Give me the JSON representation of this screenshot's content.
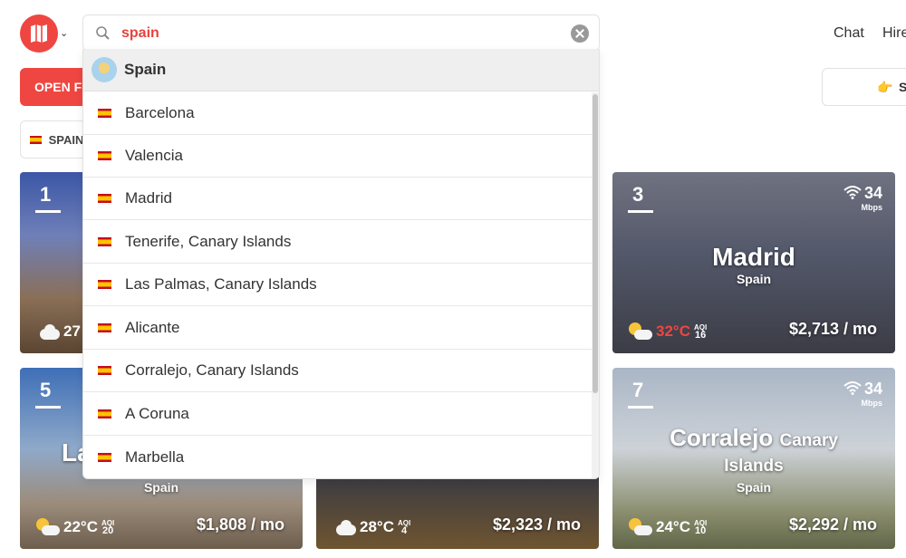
{
  "header": {
    "nav": {
      "chat": "Chat",
      "hire": "Hire"
    }
  },
  "search": {
    "value": "spain",
    "placeholder": ""
  },
  "page": {
    "open_filters_label": "OPEN FI",
    "country_chip_label": "SPAIN",
    "right_chip_label": "S"
  },
  "dropdown": {
    "header": {
      "label": "Spain",
      "icon": "globe-icon"
    },
    "items": [
      {
        "label": "Barcelona",
        "icon": "spain-flag-icon"
      },
      {
        "label": "Valencia",
        "icon": "spain-flag-icon"
      },
      {
        "label": "Madrid",
        "icon": "spain-flag-icon"
      },
      {
        "label": "Tenerife, Canary Islands",
        "icon": "spain-flag-icon"
      },
      {
        "label": "Las Palmas, Canary Islands",
        "icon": "spain-flag-icon"
      },
      {
        "label": "Alicante",
        "icon": "spain-flag-icon"
      },
      {
        "label": "Corralejo, Canary Islands",
        "icon": "spain-flag-icon"
      },
      {
        "label": "A Coruna",
        "icon": "spain-flag-icon"
      },
      {
        "label": "Marbella",
        "icon": "spain-flag-icon"
      }
    ]
  },
  "cards": {
    "c1": {
      "rank": "1",
      "temp": "27"
    },
    "c3": {
      "rank": "3",
      "city": "Madrid",
      "country": "Spain",
      "wifi": "34",
      "wifi_unit": "Mbps",
      "temp": "32°C",
      "aqi_label": "AQI",
      "aqi": "16",
      "cost": "$2,713 / mo",
      "temp_color": "#ef4641"
    },
    "c5": {
      "rank": "5",
      "city": "La",
      "country": "Spain",
      "temp": "22°C",
      "aqi_label": "AQI",
      "aqi": "20",
      "cost": "$1,808 / mo"
    },
    "c6": {
      "temp": "28°C",
      "aqi_label": "AQI",
      "aqi": "4",
      "cost": "$2,323 / mo"
    },
    "c7": {
      "rank": "7",
      "city": "Corralejo",
      "city_suffix": "Canary",
      "city_line2": "Islands",
      "country": "Spain",
      "wifi": "34",
      "wifi_unit": "Mbps",
      "temp": "24°C",
      "aqi_label": "AQI",
      "aqi": "10",
      "cost": "$2,292 / mo"
    }
  },
  "colors": {
    "brand": "#ef4641",
    "search_text": "#e8413c"
  }
}
